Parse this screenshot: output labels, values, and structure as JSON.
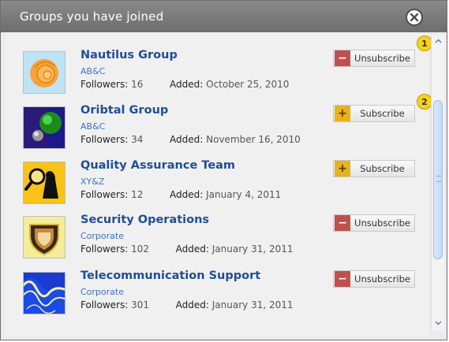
{
  "dialog": {
    "title": "Groups you have joined",
    "close_icon": "close-x-icon"
  },
  "groups": [
    {
      "name": "Nautilus Group",
      "org": "AB&C",
      "followers_label": "Followers:",
      "followers": "16",
      "added_label": "Added:",
      "added": "October 25, 2010",
      "action": "Unsubscribe",
      "action_icon": "minus"
    },
    {
      "name": "Oribtal Group",
      "org": "AB&C",
      "followers_label": "Followers:",
      "followers": "34",
      "added_label": "Added:",
      "added": "November 16, 2010",
      "action": "Subscribe",
      "action_icon": "plus"
    },
    {
      "name": "Quality Assurance Team",
      "org": "XY&Z",
      "followers_label": "Followers:",
      "followers": "12",
      "added_label": "Added:",
      "added": "January 4, 2011",
      "action": "Subscribe",
      "action_icon": "plus"
    },
    {
      "name": "Security Operations",
      "org": "Corporate",
      "followers_label": "Followers:",
      "followers": "102",
      "added_label": "Added:",
      "added": "January 31, 2011",
      "action": "Unsubscribe",
      "action_icon": "minus"
    },
    {
      "name": "Telecommunication Support",
      "org": "Corporate",
      "followers_label": "Followers:",
      "followers": "301",
      "added_label": "Added:",
      "added": "January 31, 2011",
      "action": "Unsubscribe",
      "action_icon": "minus"
    }
  ],
  "callouts": [
    "1",
    "2"
  ],
  "colors": {
    "titlebar": "#7a7a7a",
    "link": "#1f4e96",
    "org": "#3b73c2",
    "unsubscribe_icon": "#c0504d",
    "subscribe_icon": "#e8b21c",
    "callout": "#f6d21e"
  }
}
